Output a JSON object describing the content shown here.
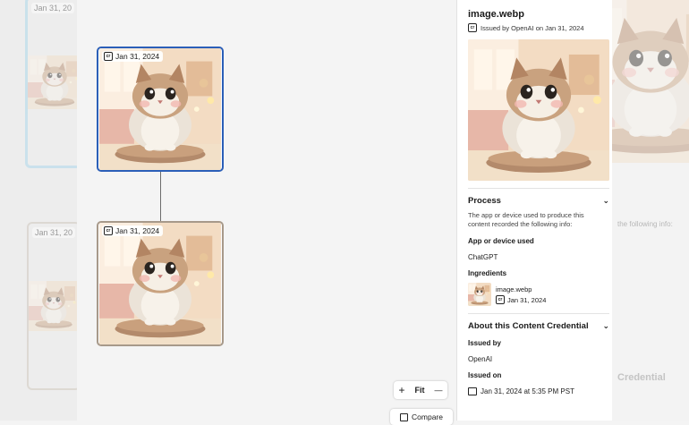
{
  "background_left": {
    "ghost_date": "Jan 31, 20",
    "ghost_date_2": "Jan 31, 20"
  },
  "canvas": {
    "node_top": {
      "date": "Jan 31, 2024"
    },
    "node_bottom": {
      "date": "Jan 31, 2024"
    },
    "zoom": {
      "zoom_in": "+",
      "fit": "Fit",
      "zoom_out": "—"
    },
    "compare_label": "Compare"
  },
  "panel": {
    "title": "image.webp",
    "issued_line": "Issued by OpenAI on Jan 31, 2024",
    "process": {
      "heading": "Process",
      "description": "The app or device used to produce this content recorded the following info:",
      "app_label": "App or device used",
      "app_value": "ChatGPT",
      "ingredients_label": "Ingredients",
      "ingredient_name": "image.webp",
      "ingredient_date": "Jan 31, 2024"
    },
    "about": {
      "heading": "About this Content Credential",
      "issued_by_label": "Issued by",
      "issued_by_value": "OpenAI",
      "issued_on_label": "Issued on",
      "issued_on_value": "Jan 31, 2024 at 5:35 PM PST"
    }
  },
  "background_right": {
    "faded_1": "the following info:",
    "faded_2": "Credential"
  },
  "colors": {
    "selected_border": "#2b5fb8",
    "node_border": "#a7998a",
    "ghost_border": "#9fd3ea"
  }
}
